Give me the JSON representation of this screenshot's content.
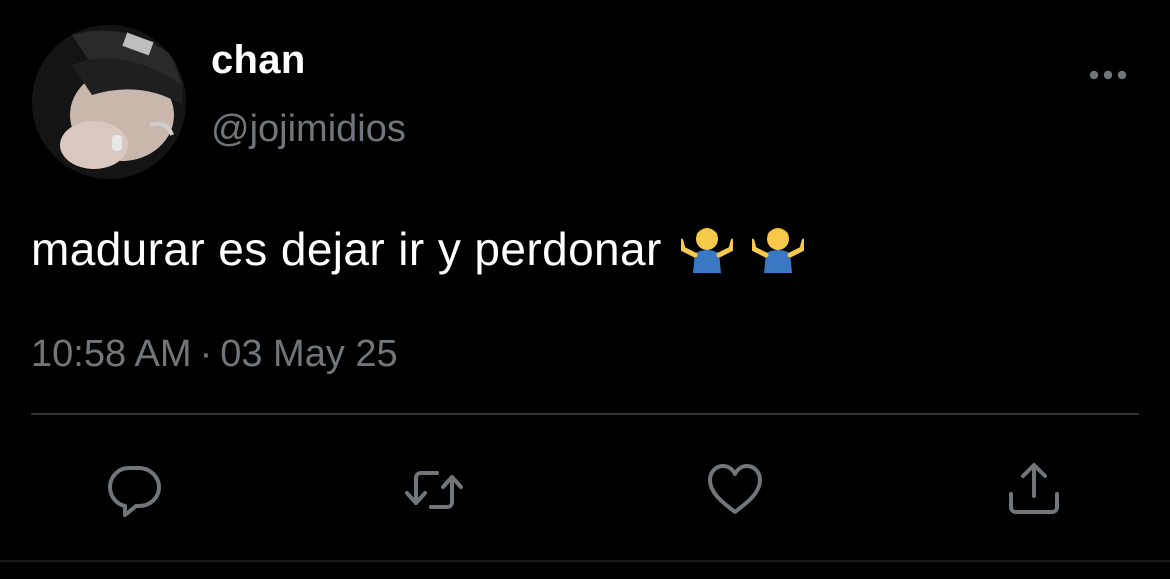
{
  "author": {
    "display_name": "chan",
    "handle": "@jojimidios"
  },
  "tweet": {
    "text": "madurar es dejar ir y perdonar",
    "emojis": [
      "man-shrugging-emoji",
      "man-shrugging-emoji"
    ],
    "time": "10:58 AM",
    "separator": "·",
    "date": "03 May 25"
  },
  "actions": {
    "icons": [
      "reply-icon",
      "retweet-icon",
      "like-icon",
      "share-icon"
    ]
  },
  "colors": {
    "background": "#000000",
    "text_primary": "#ffffff",
    "text_secondary": "#71767b",
    "divider": "#2f3336"
  }
}
